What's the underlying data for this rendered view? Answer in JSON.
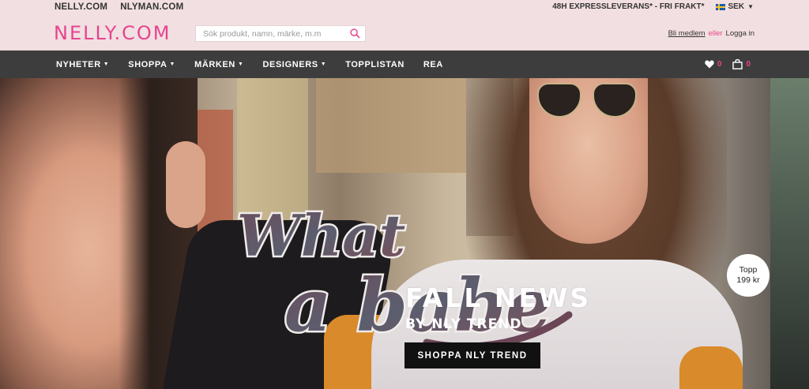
{
  "top_links": [
    "NELLY.COM",
    "NLYMAN.COM"
  ],
  "promo_text": "48H EXPRESSLEVERANS* - FRI FRAKT*",
  "currency": "SEK",
  "logo": "NELLY.COM",
  "search": {
    "placeholder": "Sök produkt, namn, märke, m.m"
  },
  "account": {
    "join": "Bli medlem",
    "or": "eller",
    "login": "Logga in"
  },
  "nav": {
    "items": [
      {
        "label": "NYHETER",
        "dropdown": true
      },
      {
        "label": "SHOPPA",
        "dropdown": true
      },
      {
        "label": "MÄRKEN",
        "dropdown": true
      },
      {
        "label": "DESIGNERS",
        "dropdown": true
      },
      {
        "label": "TOPPLISTAN",
        "dropdown": false
      },
      {
        "label": "REA",
        "dropdown": false
      }
    ],
    "wishlist_count": "0",
    "cart_count": "0"
  },
  "hero": {
    "script_line1": "What",
    "script_line2": "a babe",
    "headline": "FALL NEWS",
    "subheadline": "BY NLY TREND",
    "cta": "SHOPPA NLY TREND",
    "badge_line1": "Topp",
    "badge_line2": "199 kr"
  },
  "colors": {
    "brand_pink": "#e5458e",
    "nav_bg": "#3d3d3d",
    "header_bg": "#f2dfe1"
  }
}
